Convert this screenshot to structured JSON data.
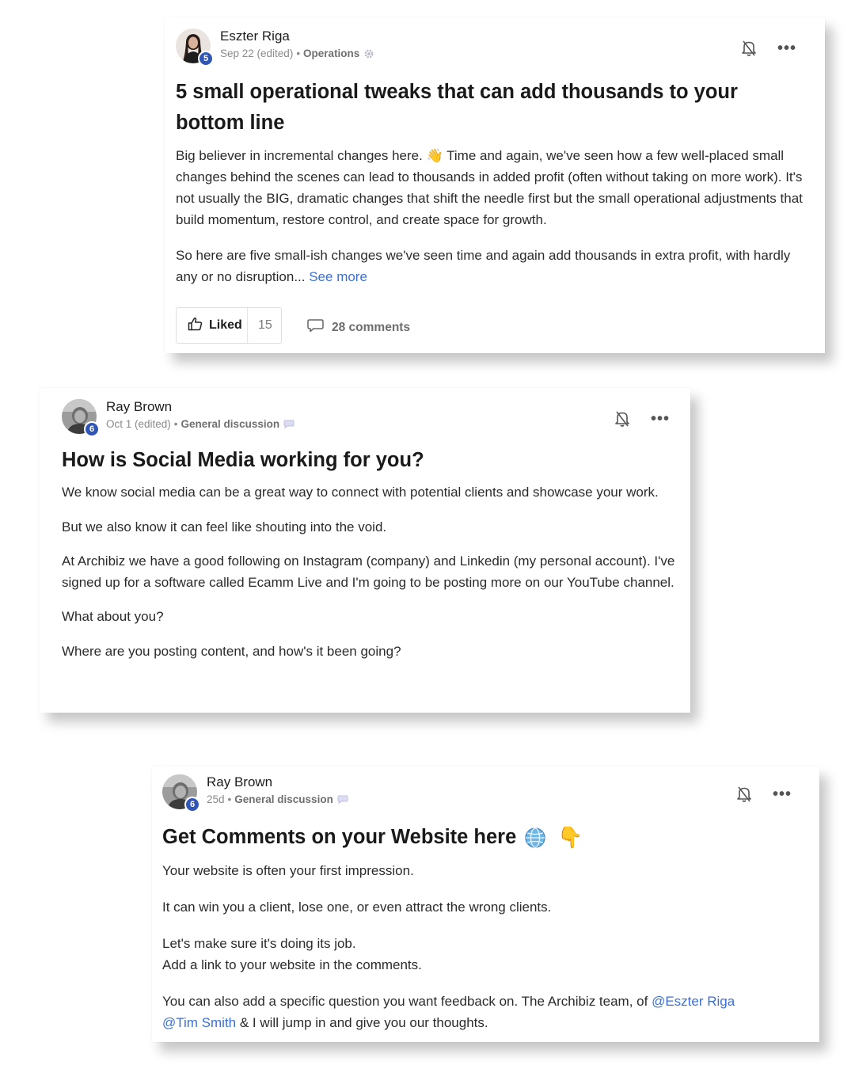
{
  "posts": [
    {
      "author": "Eszter Riga",
      "level": "5",
      "date": "Sep 22 (edited)",
      "separator": "•",
      "category": "Operations",
      "category_icon": "gear-icon",
      "title": "5 small operational tweaks that can add thousands to your bottom line",
      "paragraphs": [
        "Big believer in incremental changes here. 👋 Time and again, we've seen how a few well-placed small changes behind the scenes can lead to thousands in added profit (often without taking on more work). It's not usually the BIG, dramatic changes that shift the needle first but the small operational adjustments that build momentum, restore control, and create space for growth.",
        "So here are five small-ish changes we've seen time and again add thousands in extra profit, with hardly any or no disruption..."
      ],
      "see_more": "See more",
      "like_label": "Liked",
      "like_count": "15",
      "comments_label": "28 comments"
    },
    {
      "author": "Ray Brown",
      "level": "6",
      "date": "Oct 1 (edited)",
      "separator": "•",
      "category": "General discussion",
      "category_icon": "speech-bubble-icon",
      "title": "How is Social Media working for you?",
      "paragraphs": [
        "We know social media can be a great way to connect with potential clients and showcase your work.",
        "But we also know it can feel like shouting into the void.",
        "At Archibiz we have a good following on Instagram (company) and Linkedin (my personal account). I've signed up for a software called Ecamm Live and I'm going to be posting more on our YouTube channel.",
        "What about you?",
        "Where are you posting content, and how's it been going?"
      ]
    },
    {
      "author": "Ray Brown",
      "level": "6",
      "date": "25d",
      "separator": "•",
      "category": "General discussion",
      "category_icon": "speech-bubble-icon",
      "title": "Get Comments on your Website here",
      "title_emoji": "👇",
      "paragraphs": [
        "Your website is often your first impression.",
        "It can win you a client, lose one, or even attract the wrong clients.",
        "Let's make sure it's doing its job.",
        "Add a link to your website in the comments.",
        "You can also add a specific question you want feedback on. The Archibiz team, of",
        "& I will jump in and give you our thoughts."
      ],
      "mentions": [
        "@Eszter Riga",
        "@Tim Smith"
      ]
    }
  ],
  "colors": {
    "link": "#3b6fd4",
    "badge": "#2f55b5",
    "text": "#2b2b2b",
    "meta": "#8a8a8a"
  }
}
